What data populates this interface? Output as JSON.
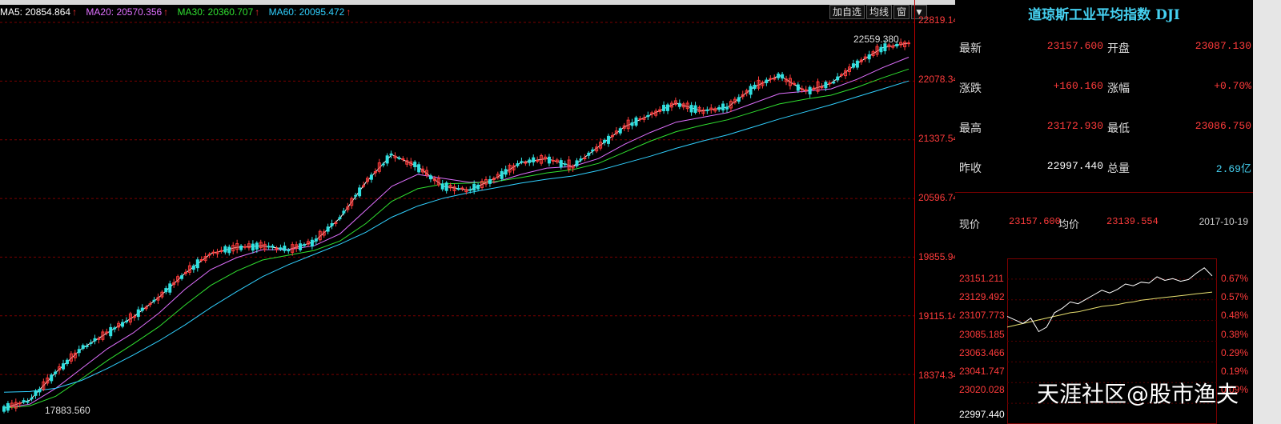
{
  "ma_legend": [
    {
      "label": "MA5: 20854.864",
      "color": "#ffffff"
    },
    {
      "label": "MA20: 20570.356",
      "color": "#e070ff"
    },
    {
      "label": "MA30: 20360.707",
      "color": "#30e030"
    },
    {
      "label": "MA60: 20095.472",
      "color": "#30d0ff"
    }
  ],
  "ma_arrow": "↑",
  "toolbar": {
    "add_watch": "加自选",
    "avg_line": "均线",
    "window": "窗",
    "dropdown": "▼"
  },
  "y_axis": [
    "22819.14",
    "22078.34",
    "21337.54",
    "20596.74",
    "19855.94",
    "19115.14",
    "18374.34"
  ],
  "price_markers": {
    "high": "22559.380",
    "low": "17883.560"
  },
  "panel": {
    "title": "道琼斯工业平均指数 DJI",
    "rows": [
      {
        "l1": "最新",
        "v1": "23157.600",
        "l2": "开盘",
        "v2": "23087.130"
      },
      {
        "l1": "涨跌",
        "v1": "+160.160",
        "l2": "涨幅",
        "v2": "+0.70%"
      },
      {
        "l1": "最高",
        "v1": "23172.930",
        "l2": "最低",
        "v2": "23086.750"
      },
      {
        "l1": "昨收",
        "v1": "22997.440",
        "l2": "总量",
        "v2": "2.69亿"
      }
    ],
    "intraday": {
      "now_label": "现价",
      "now_value": "23157.600",
      "avg_label": "均价",
      "avg_value": "23139.554",
      "date": "2017-10-19"
    },
    "left_ticks": [
      "23151.211",
      "23129.492",
      "23107.773",
      "23085.185",
      "23063.466",
      "23041.747",
      "23020.028",
      "22997.440"
    ],
    "right_ticks": [
      "0.67%",
      "0.57%",
      "0.48%",
      "0.38%",
      "0.29%",
      "0.19%",
      "0.09%"
    ]
  },
  "watermark": "天涯社区@股市渔夫",
  "chart_data": {
    "type": "line",
    "title": "",
    "series": [
      {
        "name": "MA5",
        "color": "#ffffff",
        "values": [
          17950,
          18050,
          18400,
          18700,
          18900,
          19100,
          19350,
          19650,
          19900,
          19980,
          20000,
          19950,
          20050,
          20350,
          20800,
          21150,
          21000,
          20750,
          20700,
          20850,
          21050,
          21100,
          21000,
          21250,
          21500,
          21650,
          21800,
          21700,
          21750,
          22000,
          22150,
          21950,
          22050,
          22300,
          22500,
          22559
        ]
      },
      {
        "name": "MA20",
        "color": "#e070ff",
        "values": [
          17950,
          18000,
          18200,
          18450,
          18700,
          18900,
          19150,
          19450,
          19700,
          19850,
          19950,
          19950,
          20000,
          20150,
          20450,
          20750,
          20900,
          20850,
          20800,
          20800,
          20900,
          20980,
          21000,
          21100,
          21280,
          21430,
          21560,
          21620,
          21680,
          21800,
          21920,
          21950,
          21980,
          22100,
          22250,
          22380
        ]
      },
      {
        "name": "MA30",
        "color": "#30e030",
        "values": [
          17950,
          17980,
          18100,
          18320,
          18550,
          18760,
          18980,
          19250,
          19500,
          19680,
          19820,
          19880,
          19940,
          20060,
          20280,
          20560,
          20720,
          20780,
          20790,
          20810,
          20860,
          20920,
          20960,
          21040,
          21180,
          21320,
          21440,
          21520,
          21590,
          21690,
          21790,
          21850,
          21900,
          22000,
          22120,
          22230
        ]
      },
      {
        "name": "MA60",
        "color": "#30d0ff",
        "values": [
          18150,
          18160,
          18200,
          18300,
          18450,
          18620,
          18800,
          19000,
          19220,
          19420,
          19610,
          19760,
          19890,
          20020,
          20170,
          20360,
          20500,
          20600,
          20670,
          20730,
          20790,
          20840,
          20880,
          20950,
          21040,
          21130,
          21230,
          21320,
          21400,
          21500,
          21600,
          21690,
          21780,
          21880,
          21980,
          22080
        ]
      }
    ],
    "ylim": [
      17800,
      22900
    ],
    "intraday": {
      "price": [
        23112,
        23108,
        23104,
        23110,
        23095,
        23100,
        23116,
        23121,
        23128,
        23126,
        23131,
        23136,
        23141,
        23138,
        23142,
        23148,
        23146,
        23150,
        23149,
        23156,
        23152,
        23154,
        23151,
        23153,
        23160,
        23166,
        23157
      ],
      "avg": [
        23100,
        23102,
        23104,
        23106,
        23108,
        23110,
        23112,
        23114,
        23116,
        23117,
        23119,
        23121,
        23123,
        23124,
        23125,
        23127,
        23128,
        23130,
        23131,
        23132,
        23133,
        23134,
        23135,
        23136,
        23137,
        23138,
        23139
      ],
      "ylim": [
        22997.44,
        23172.93
      ]
    }
  }
}
